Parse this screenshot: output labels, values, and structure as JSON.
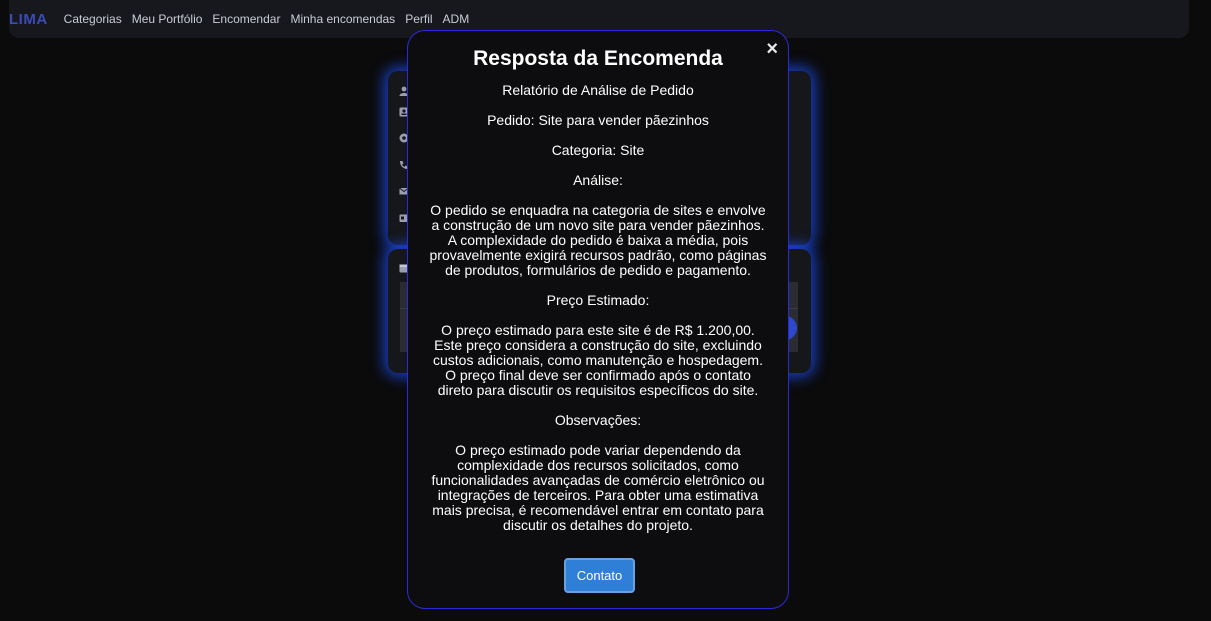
{
  "navbar": {
    "brand": "LIMA",
    "links": [
      "Categorias",
      "Meu Portfólio",
      "Encomendar",
      "Minha encomendas",
      "Perfil",
      "ADM"
    ]
  },
  "modal": {
    "title": "Resposta da Encomenda",
    "close_icon": "×",
    "paragraphs": [
      "Relatório de Análise de Pedido",
      "Pedido: Site para vender pãezinhos",
      "Categoria: Site",
      "Análise:",
      "O pedido se enquadra na categoria de sites e envolve a construção de um novo site para vender pãezinhos. A complexidade do pedido é baixa a média, pois provavelmente exigirá recursos padrão, como páginas de produtos, formulários de pedido e pagamento.",
      "Preço Estimado:",
      "O preço estimado para este site é de R$ 1.200,00. Este preço considera a construção do site, excluindo custos adicionais, como manutenção e hospedagem. O preço final deve ser confirmado após o contato direto para discutir os requisitos específicos do site.",
      "Observações:",
      "O preço estimado pode variar dependendo da complexidade dos recursos solicitados, como funcionalidades avançadas de comércio eletrônico ou integrações de terceiros. Para obter uma estimativa mais precisa, é recomendável entrar em contato para discutir os detalhes do projeto."
    ],
    "contact_label": "Contato"
  },
  "colors": {
    "brand": "#3b4ab8",
    "modal_border": "#2b2bd6",
    "card_glow": "#1e50ff",
    "button": "#2f7fd6"
  },
  "icons": {
    "profile_card": [
      "user-icon",
      "id-card-icon",
      "at-sign-icon",
      "phone-icon",
      "envelope-icon",
      "id-badge-icon"
    ],
    "orders_card": [
      "calendar-icon"
    ]
  }
}
